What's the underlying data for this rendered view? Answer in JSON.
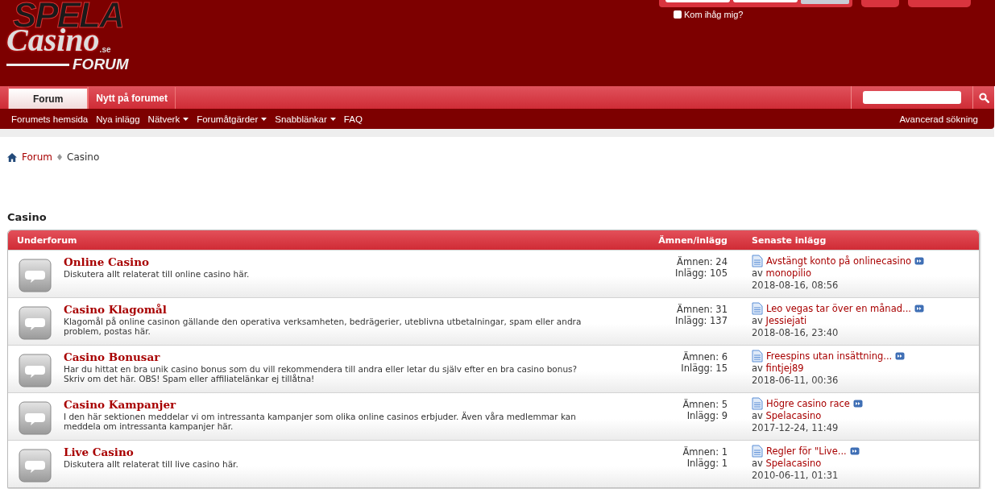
{
  "logo": {
    "line_1": "SPELA",
    "line_2": "Casino",
    "suffix": ".se",
    "line_3": "FORUM"
  },
  "login": {
    "remember_me": {
      "label": "Kom ihåg mig?",
      "checked": false
    }
  },
  "tabs": [
    {
      "label": "Forum",
      "selected": true
    },
    {
      "label": "Nytt på forumet",
      "selected": false
    }
  ],
  "subnav": {
    "links": [
      {
        "label": "Forumets hemsida",
        "dropdown": false
      },
      {
        "label": "Nya inlägg",
        "dropdown": false
      },
      {
        "label": "Nätverk",
        "dropdown": true
      },
      {
        "label": "Forumåtgärder",
        "dropdown": true
      },
      {
        "label": "Snabblänkar",
        "dropdown": true
      },
      {
        "label": "FAQ",
        "dropdown": false
      }
    ],
    "advanced_search": "Avancerad sökning"
  },
  "breadcrumb": [
    "Forum",
    "Casino"
  ],
  "section_title": "Casino",
  "table": {
    "columns": [
      "Underforum",
      "Ämnen/inlägg",
      "Senaste inlägg"
    ],
    "rows": [
      {
        "title": "Online Casino",
        "description": "Diskutera allt relaterat till online casino här.",
        "topics": "Ämnen: 24",
        "posts": "Inlägg: 105",
        "last_post": {
          "title": "Avstängt konto på onlinecasino",
          "by": "av",
          "user": "monopilio",
          "date": "2018-08-16, 08:56"
        }
      },
      {
        "title": "Casino Klagomål",
        "description": "Klagomål på online casinon gällande den operativa verksamheten, bedrägerier, uteblivna utbetalningar, spam eller andra problem, postas här.",
        "topics": "Ämnen: 31",
        "posts": "Inlägg: 137",
        "last_post": {
          "title": "Leo vegas tar över en månad...",
          "by": "av",
          "user": "Jessiejati",
          "date": "2018-08-16, 23:40"
        }
      },
      {
        "title": "Casino Bonusar",
        "description": "Har du hittat en bra unik casino bonus som du vill rekommendera till andra eller letar du själv efter en bra casino bonus? Skriv om det här. OBS! Spam eller affiliatelänkar ej tillåtna!",
        "topics": "Ämnen: 6",
        "posts": "Inlägg: 15",
        "last_post": {
          "title": "Freespins utan insättning...",
          "by": "av",
          "user": "fintjej89",
          "date": "2018-06-11, 00:36"
        }
      },
      {
        "title": "Casino Kampanjer",
        "description": "I den här sektionen meddelar vi om intressanta kampanjer som olika online casinos erbjuder. Även våra medlemmar kan meddela om intressanta kampanjer här.",
        "topics": "Ämnen: 5",
        "posts": "Inlägg: 9",
        "last_post": {
          "title": "Högre casino race",
          "by": "av",
          "user": "Spelacasino",
          "date": "2017-12-24, 11:49"
        }
      },
      {
        "title": "Live Casino",
        "description": "Diskutera allt relaterat till live casino här.",
        "topics": "Ämnen: 1",
        "posts": "Inlägg: 1",
        "last_post": {
          "title": "Regler för \"Live...",
          "by": "av",
          "user": "Spelacasino",
          "date": "2010-06-11, 01:31"
        }
      }
    ]
  }
}
